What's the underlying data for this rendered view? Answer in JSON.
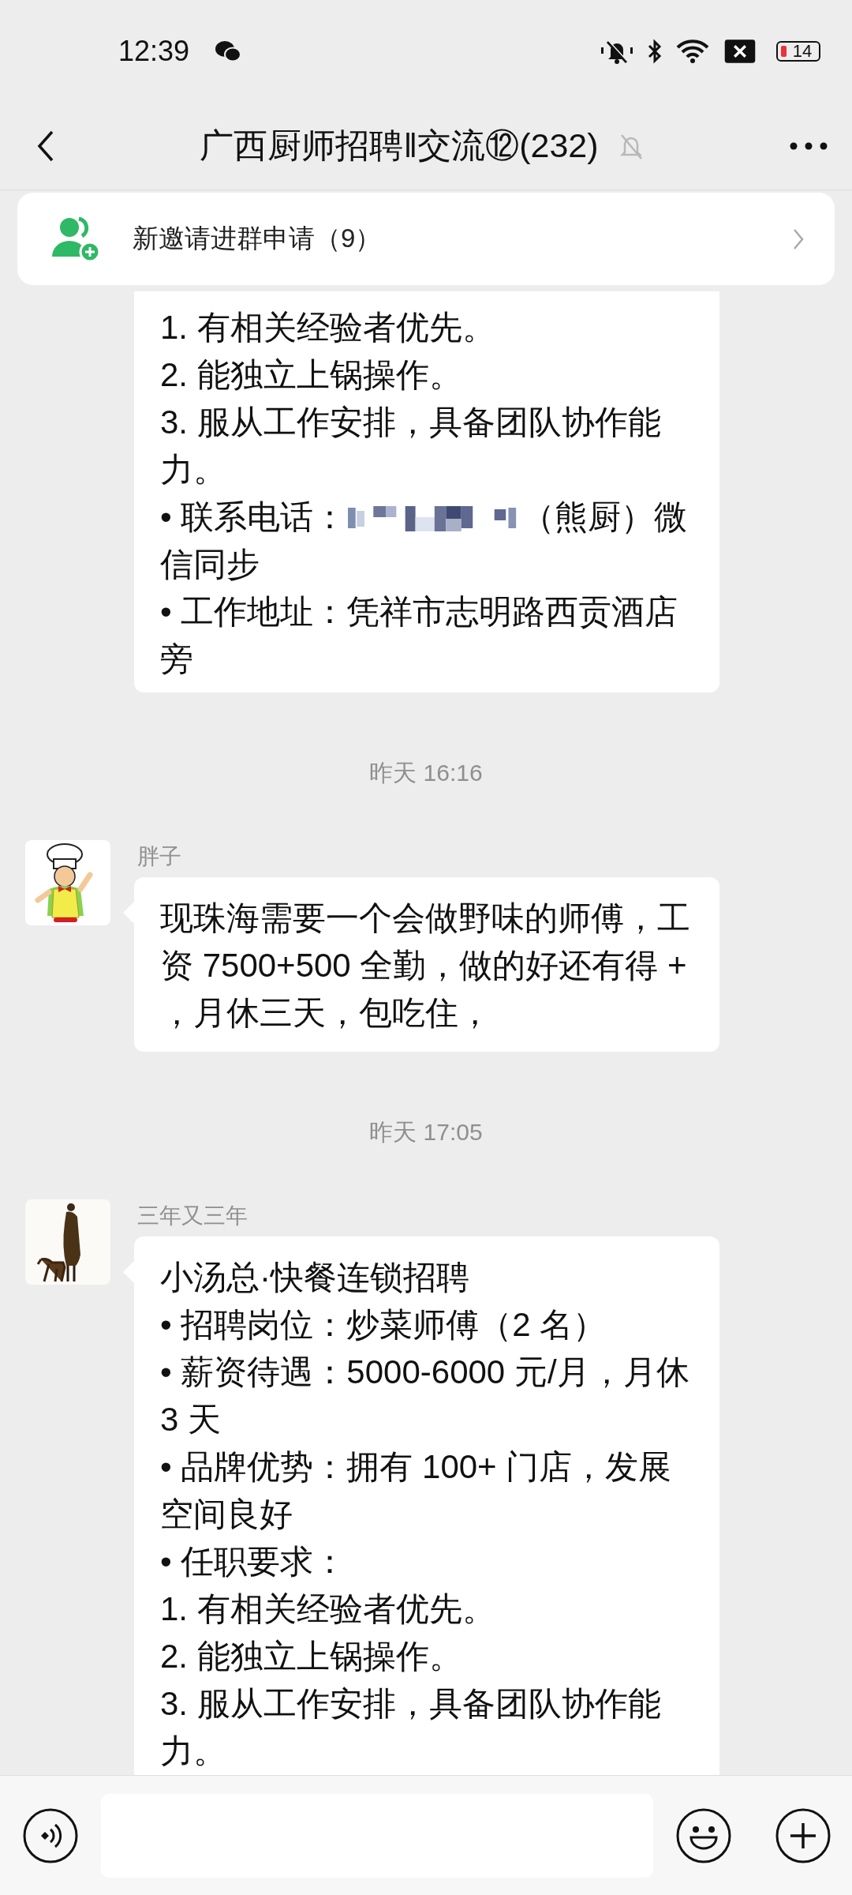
{
  "status_bar": {
    "time": "12:39",
    "battery": "14"
  },
  "header": {
    "title": "广西厨师招聘‖交流⑫(232)",
    "muted": true
  },
  "invite_banner": {
    "label": "新邀请进群申请（9）"
  },
  "feed": [
    {
      "kind": "message",
      "paragraphs": [
        {
          "text": "1. 有相关经验者优先。"
        },
        {
          "text": "2. 能独立上锅操作。"
        },
        {
          "text": "3. 服从工作安排，具备团队协作能力。"
        },
        {
          "text": "• 联系电话：",
          "redacted": true,
          "after": "（熊厨）微信同步"
        },
        {
          "text": "• 工作地址：凭祥市志明路西贡酒店旁"
        }
      ]
    },
    {
      "kind": "timestamp",
      "text": "昨天 16:16"
    },
    {
      "kind": "message",
      "sender": "胖子",
      "paragraphs": [
        {
          "text": "现珠海需要一个会做野味的师傅，工资 7500+500 全勤，做的好还有得 + ，月休三天，包吃住，"
        }
      ]
    },
    {
      "kind": "timestamp",
      "text": "昨天 17:05"
    },
    {
      "kind": "message",
      "sender": "三年又三年",
      "paragraphs": [
        {
          "text": "小汤总·快餐连锁招聘"
        },
        {
          "text": "• 招聘岗位：炒菜师傅（2 名）"
        },
        {
          "text": "• 薪资待遇：5000-6000 元/月，月休 3 天"
        },
        {
          "text": "• 品牌优势：拥有 100+ 门店，发展空间良好"
        },
        {
          "text": "• 任职要求："
        },
        {
          "text": "1. 有相关经验者优先。"
        },
        {
          "text": "2. 能独立上锅操作。"
        },
        {
          "text": "3. 服从工作安排，具备团队协作能力。"
        }
      ]
    }
  ]
}
